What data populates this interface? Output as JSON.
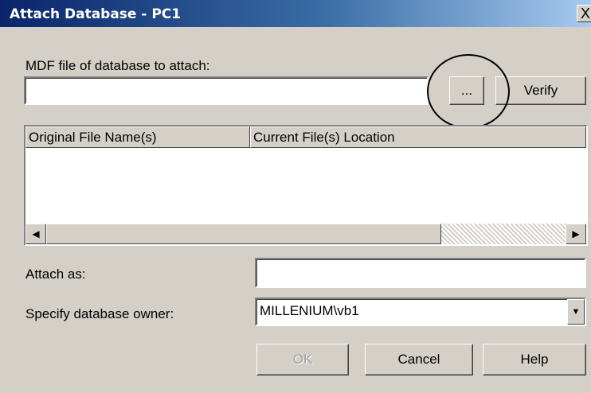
{
  "window": {
    "title": "Attach Database - PC1",
    "close_glyph": "X"
  },
  "mdf": {
    "label": "MDF file of database to attach:",
    "value": "",
    "browse_label": "...",
    "verify_label": "Verify"
  },
  "files_list": {
    "columns": [
      "Original File Name(s)",
      "Current File(s) Location"
    ],
    "rows": []
  },
  "attach_as": {
    "label": "Attach as:",
    "value": ""
  },
  "owner": {
    "label": "Specify database owner:",
    "value": "MILLENIUM\\vb1"
  },
  "buttons": {
    "ok": "OK",
    "cancel": "Cancel",
    "help": "Help"
  },
  "icons": {
    "scroll_left": "◀",
    "scroll_right": "▶",
    "dropdown": "▼"
  }
}
